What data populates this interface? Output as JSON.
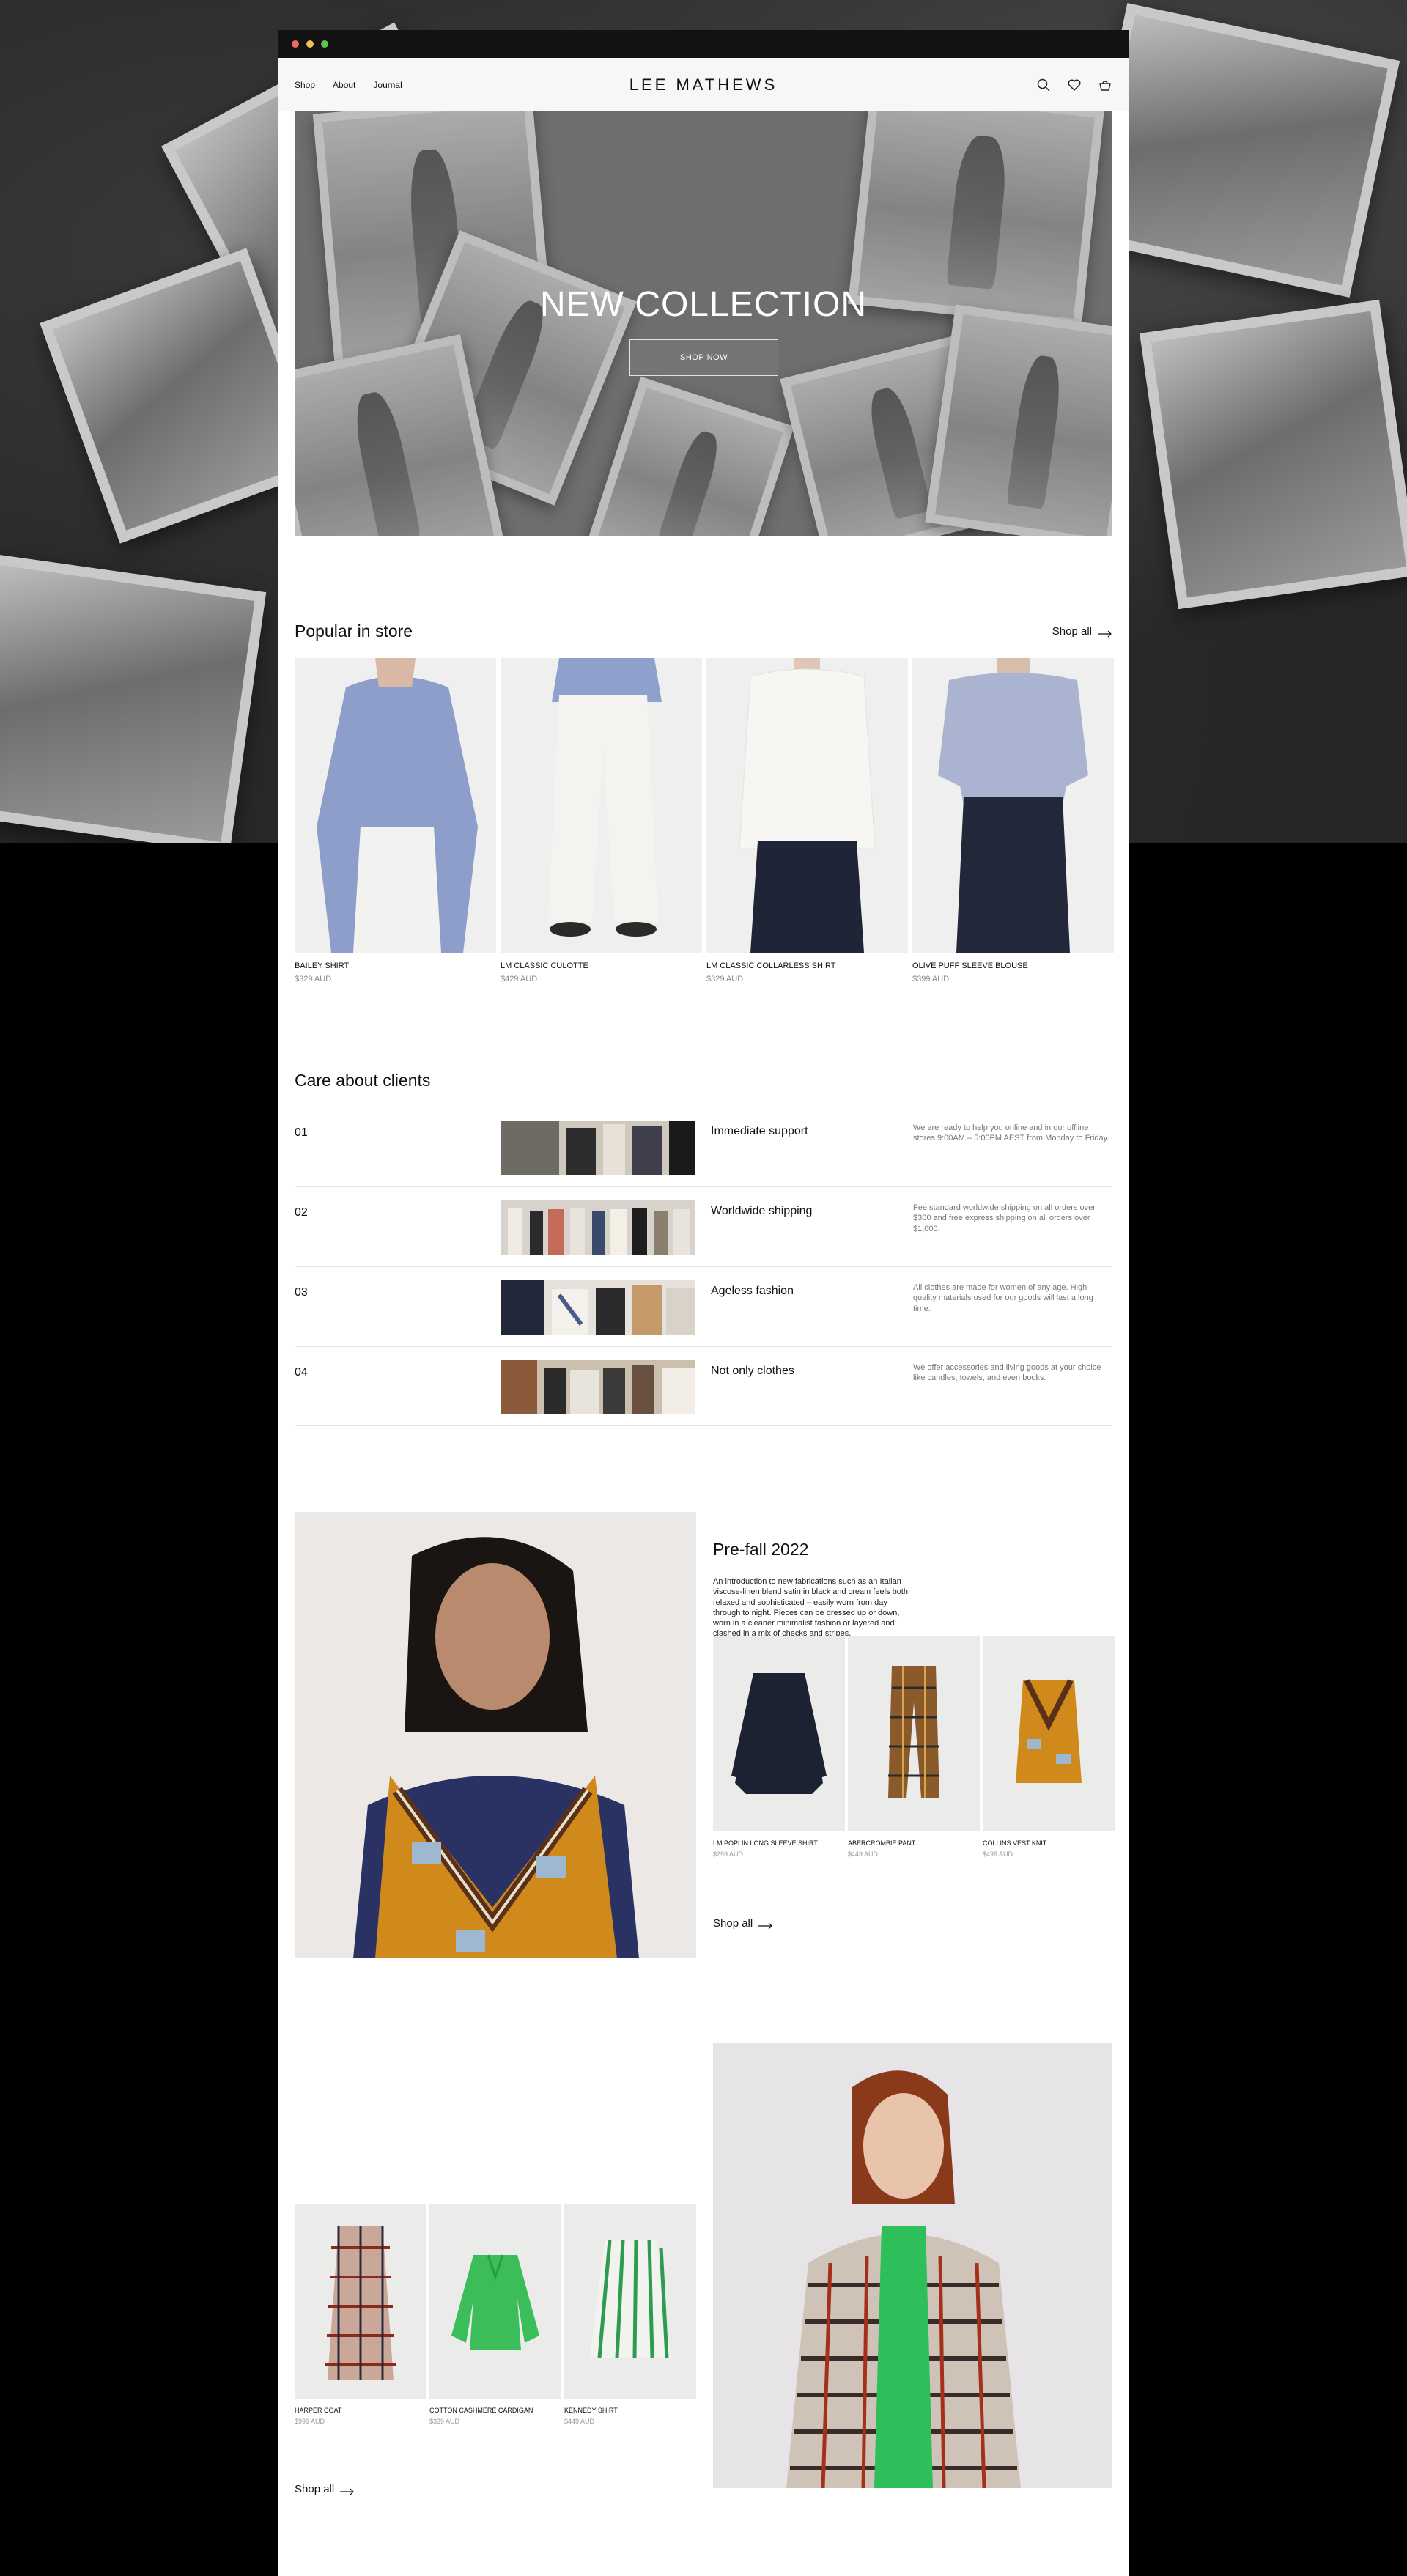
{
  "header": {
    "nav": [
      "Shop",
      "About",
      "Journal"
    ],
    "logo": "LEE MATHEWS",
    "icons": [
      "search-icon",
      "heart-icon",
      "bag-icon"
    ]
  },
  "hero": {
    "title": "NEW COLLECTION",
    "button": "SHOP NOW"
  },
  "popular": {
    "title": "Popular in store",
    "shop_all": "Shop all",
    "products": [
      {
        "name": "BAILEY SHIRT",
        "price": "$329 AUD"
      },
      {
        "name": "LM CLASSIC CULOTTE",
        "price": "$429 AUD"
      },
      {
        "name": "LM CLASSIC COLLARLESS SHIRT",
        "price": "$329 AUD"
      },
      {
        "name": "OLIVE PUFF SLEEVE BLOUSE",
        "price": "$399 AUD"
      }
    ]
  },
  "care": {
    "title": "Care about clients",
    "rows": [
      {
        "num": "01",
        "title": "Immediate support",
        "text": "We are ready to help you online and in our offline stores 9:00AM – 5:00PM AEST from Monday to Friday."
      },
      {
        "num": "02",
        "title": "Worldwide shipping",
        "text": "Fee standard worldwide shipping on all orders over $300 and free express shipping on all orders over $1,000."
      },
      {
        "num": "03",
        "title": "Ageless fashion",
        "text": "All clothes are made for women of any age. High quality materials used for our goods will last a long time."
      },
      {
        "num": "04",
        "title": "Not only clothes",
        "text": "We offer accessories and living goods at your choice like candles, towels, and even books."
      }
    ]
  },
  "prefall": {
    "title": "Pre-fall 2022",
    "description": "An introduction to new fabrications such as an Italian viscose-linen blend satin in black and cream feels both relaxed and sophisticated – easily worn from day through to night. Pieces can be dressed up or down, worn in a cleaner minimalist fashion or layered and clashed in a mix of checks and stripes.",
    "shop_all": "Shop all",
    "products": [
      {
        "name": "LM POPLIN LONG SLEEVE SHIRT",
        "price": "$299 AUD"
      },
      {
        "name": "ABERCROMBIE PANT",
        "price": "$449 AUD"
      },
      {
        "name": "COLLINS VEST KNIT",
        "price": "$499 AUD"
      }
    ]
  },
  "second": {
    "shop_all": "Shop all",
    "products": [
      {
        "name": "HARPER COAT",
        "price": "$999 AUD"
      },
      {
        "name": "COTTON CASHMERE CARDIGAN",
        "price": "$339 AUD"
      },
      {
        "name": "KENNEDY SHIRT",
        "price": "$449 AUD"
      }
    ]
  },
  "colors": {
    "accent": "#111111",
    "muted": "#888888",
    "background": "#ffffff"
  }
}
